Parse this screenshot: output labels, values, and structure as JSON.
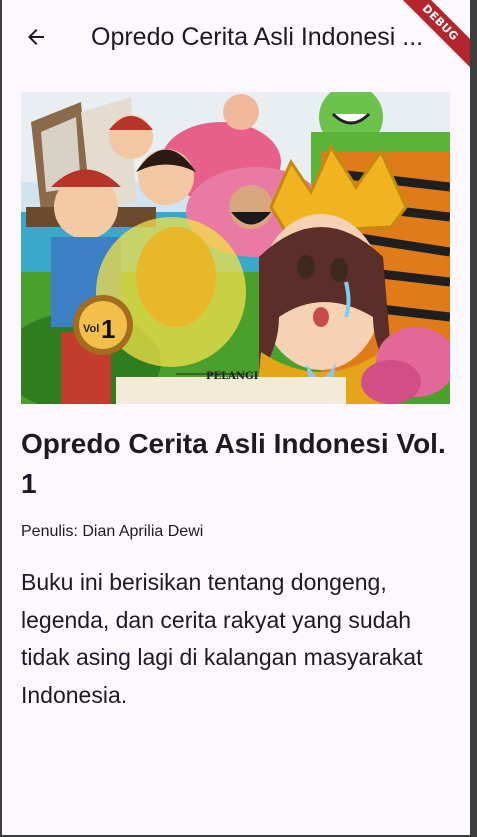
{
  "appbar": {
    "title": "Opredo Cerita Asli Indonesi ...",
    "back_icon": "arrow-left-icon",
    "debug_label": "DEBUG"
  },
  "cover": {
    "badge_vol": "Vol",
    "badge_number": "1",
    "publisher": "PELANGI"
  },
  "book": {
    "title": "Opredo Cerita Asli Indonesi Vol. 1",
    "author": "Penulis: Dian Aprilia Dewi",
    "description": "Buku ini berisikan tentang dongeng, legenda, dan cerita rakyat yang sudah tidak asing lagi di kalangan masyarakat Indonesia."
  },
  "colors": {
    "background": "#fdf7ff",
    "text": "#1d1b20",
    "debug_ribbon": "#b3262b"
  }
}
